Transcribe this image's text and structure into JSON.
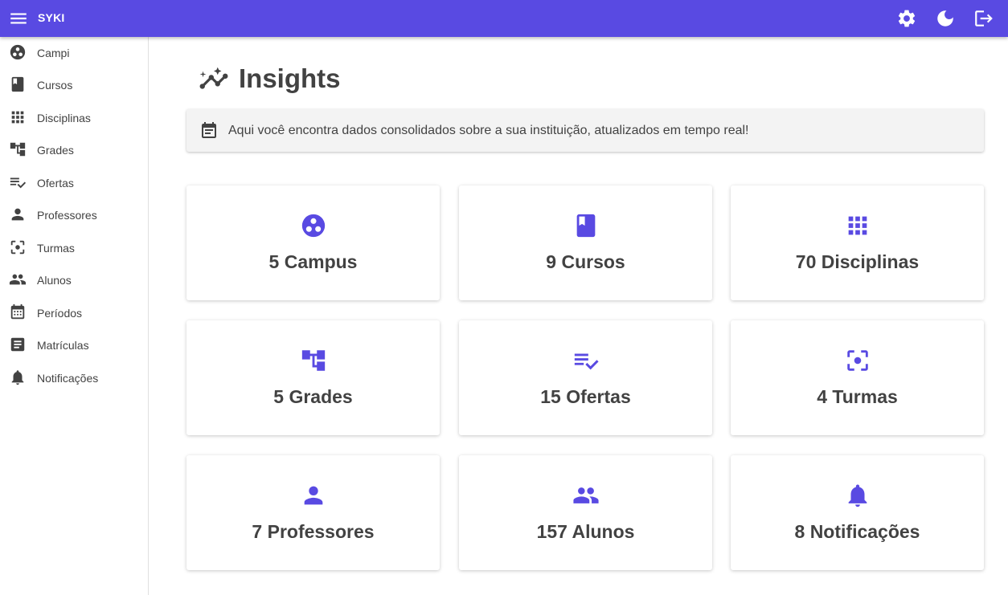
{
  "appbar": {
    "brand": "SYKI",
    "menu_icon": "menu-icon",
    "actions": [
      "settings-icon",
      "dark-mode-icon",
      "logout-icon"
    ]
  },
  "sidebar": {
    "items": [
      {
        "label": "Campi",
        "icon": "campus-icon"
      },
      {
        "label": "Cursos",
        "icon": "book-icon"
      },
      {
        "label": "Disciplinas",
        "icon": "apps-grid-icon"
      },
      {
        "label": "Grades",
        "icon": "account-tree-icon"
      },
      {
        "label": "Ofertas",
        "icon": "playlist-check-icon"
      },
      {
        "label": "Professores",
        "icon": "person-icon"
      },
      {
        "label": "Turmas",
        "icon": "center-focus-icon"
      },
      {
        "label": "Alunos",
        "icon": "people-icon"
      },
      {
        "label": "Períodos",
        "icon": "calendar-icon"
      },
      {
        "label": "Matrículas",
        "icon": "article-icon"
      },
      {
        "label": "Notificações",
        "icon": "bell-icon"
      }
    ]
  },
  "main": {
    "title": "Insights",
    "title_icon": "insights-icon",
    "banner": {
      "icon": "event-note-icon",
      "text": "Aqui você encontra dados consolidados sobre a sua instituição, atualizados em tempo real!"
    },
    "cards": [
      {
        "label": "5 Campus",
        "icon": "campus-icon"
      },
      {
        "label": "9 Cursos",
        "icon": "book-icon"
      },
      {
        "label": "70 Disciplinas",
        "icon": "apps-grid-icon"
      },
      {
        "label": "5 Grades",
        "icon": "account-tree-icon"
      },
      {
        "label": "15 Ofertas",
        "icon": "playlist-check-icon"
      },
      {
        "label": "4 Turmas",
        "icon": "center-focus-icon"
      },
      {
        "label": "7 Professores",
        "icon": "person-icon"
      },
      {
        "label": "157 Alunos",
        "icon": "people-icon"
      },
      {
        "label": "8 Notificações",
        "icon": "bell-icon"
      }
    ]
  },
  "colors": {
    "primary": "#594ae2",
    "text": "#424242",
    "banner_bg": "#f3f3f3"
  }
}
